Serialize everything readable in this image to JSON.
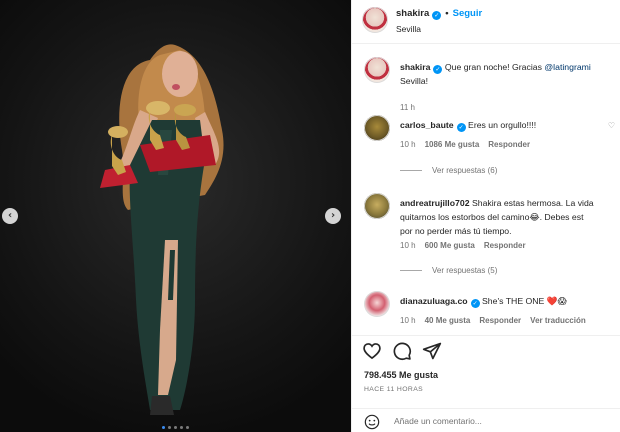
{
  "post": {
    "username": "shakira",
    "separator": "•",
    "follow_label": "Seguir",
    "location": "Sevilla",
    "media_dots": 5,
    "active_dot": 0
  },
  "caption": {
    "username": "shakira",
    "text": "Que gran noche! Gracias",
    "mention": "@latingrami",
    "text2": "Sevilla!",
    "time": "11 h"
  },
  "comments": [
    {
      "username": "carlos_baute",
      "verified": true,
      "lines": [
        "Eres un orgullo!!!!"
      ],
      "time": "10 h",
      "likes": "1086 Me gusta",
      "reply_label": "Responder",
      "view_replies": "Ver respuestas (6)"
    },
    {
      "username": "andreatrujillo702",
      "verified": false,
      "lines": [
        "Shakira estas hermosa. La vida",
        "quitarnos los estorbos del camino😂. Debes est",
        "por no perder más tú tiempo."
      ],
      "time": "10 h",
      "likes": "600 Me gusta",
      "reply_label": "Responder",
      "view_replies": "Ver respuestas (5)"
    },
    {
      "username": "dianazuluaga.co",
      "verified": true,
      "lines": [
        "She's THE ONE ❤️😱"
      ],
      "time": "10 h",
      "likes": "40 Me gusta",
      "reply_label": "Responder",
      "translate_label": "Ver traducción"
    }
  ],
  "actions": {
    "likes": "798.455 Me gusta",
    "ago": "HACE 11 HORAS",
    "comment_placeholder": "Añade un comentario..."
  },
  "colors": {
    "accent": "#0095f6",
    "muted": "#737373",
    "text": "#262626"
  }
}
